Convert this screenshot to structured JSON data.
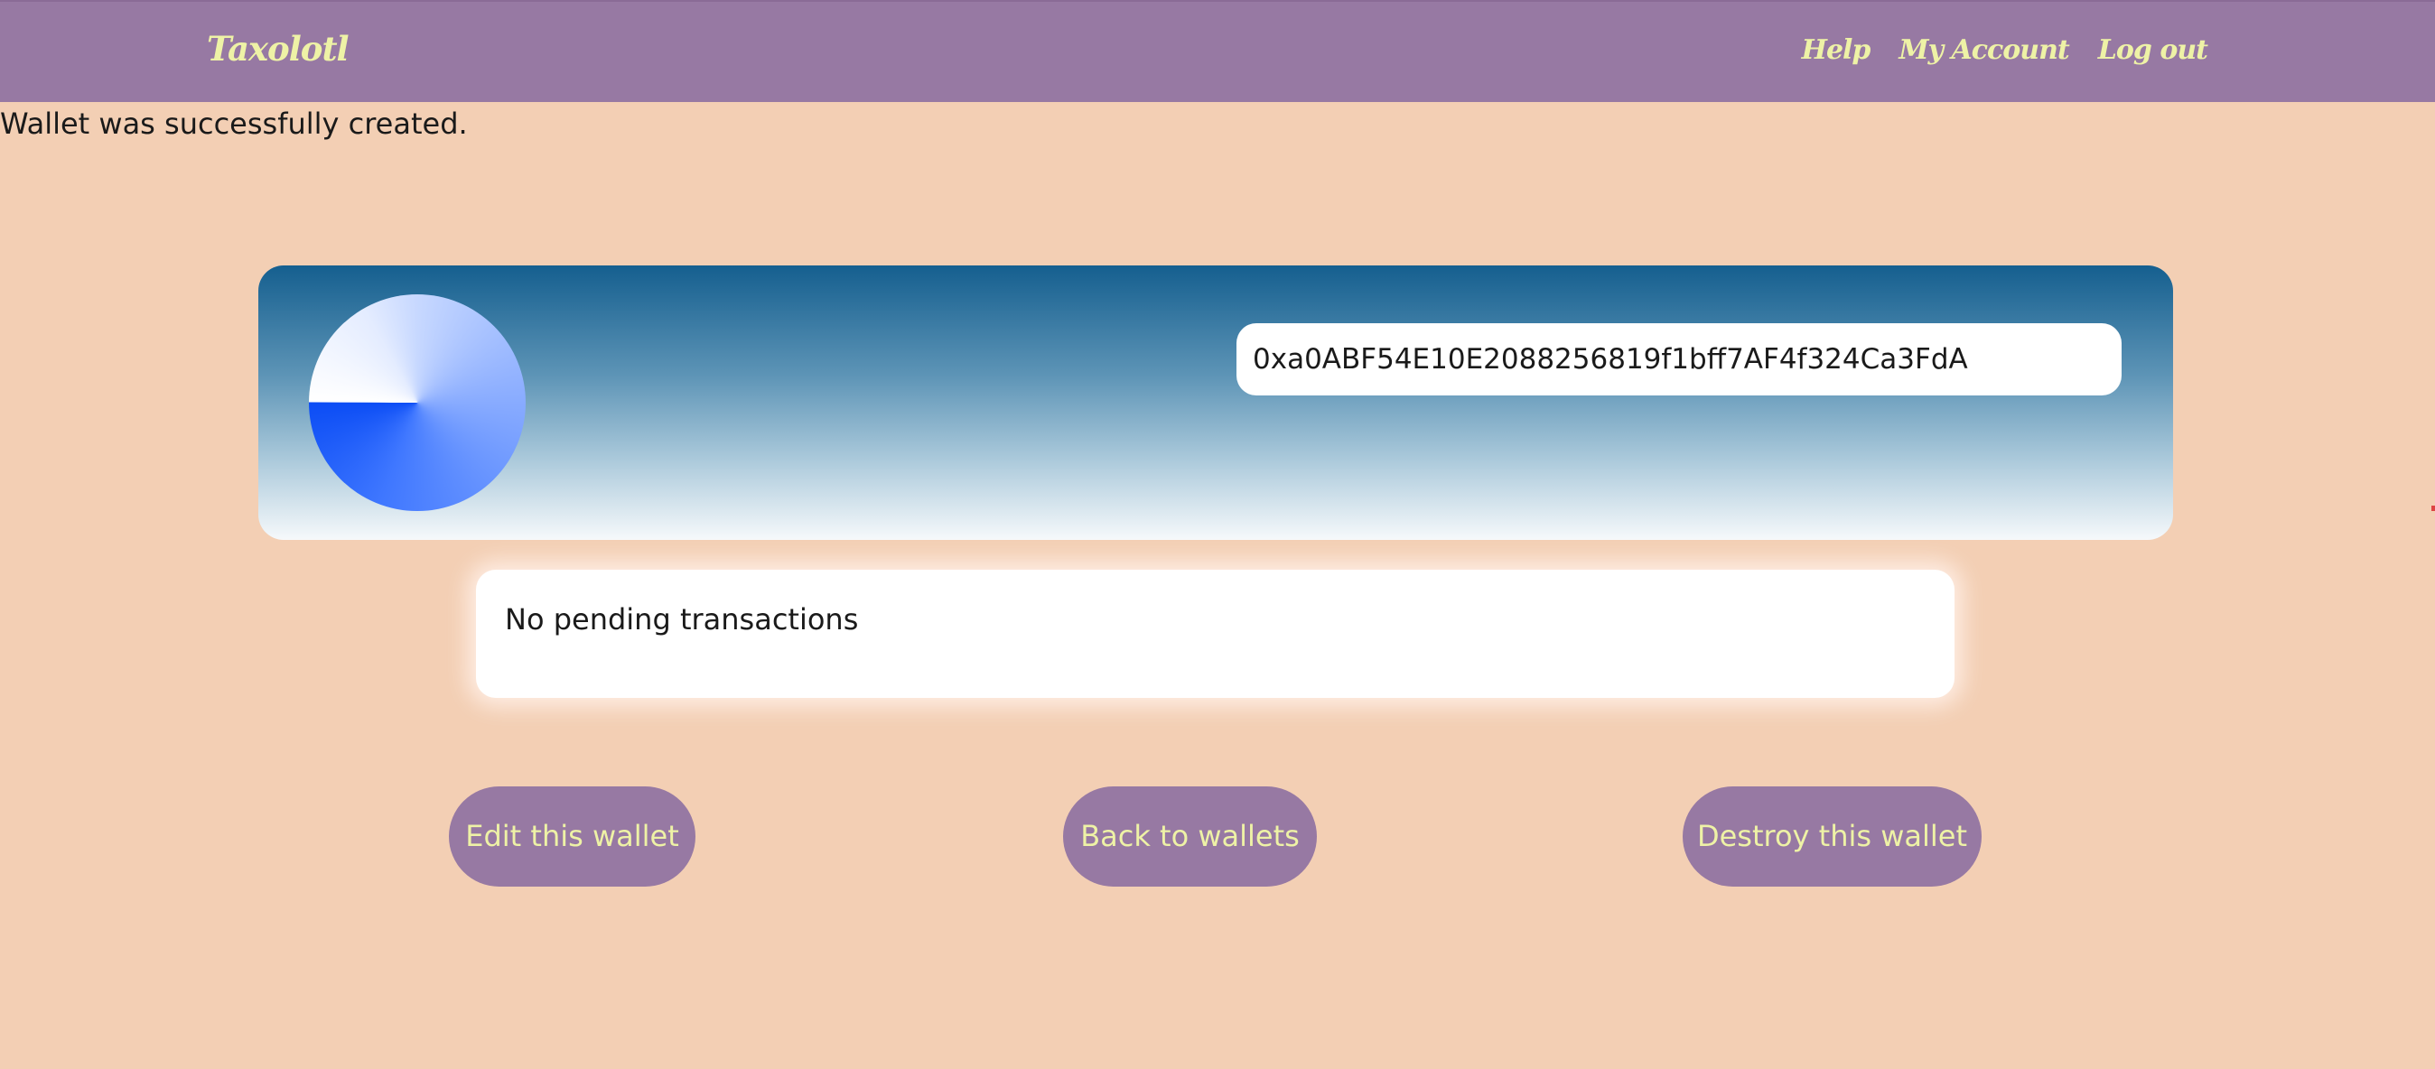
{
  "app": {
    "brand": "Taxolotl"
  },
  "nav": {
    "help": "Help",
    "account": "My Account",
    "logout": "Log out"
  },
  "flash": {
    "message": "Wallet was successfully created."
  },
  "wallet": {
    "address": "0xa0ABF54E10E2088256819f1bff7AF4f324Ca3FdA",
    "avatar_icon": "identicon-avatar"
  },
  "transactions": {
    "empty_message": "No pending transactions"
  },
  "actions": {
    "edit": "Edit this wallet",
    "back": "Back to wallets",
    "destroy": "Destroy this wallet"
  },
  "colors": {
    "navbar": "#9779a3",
    "nav_text": "#eef2a6",
    "background": "#f3cfb4",
    "card_top": "#155f8f",
    "button": "#9779a3"
  }
}
